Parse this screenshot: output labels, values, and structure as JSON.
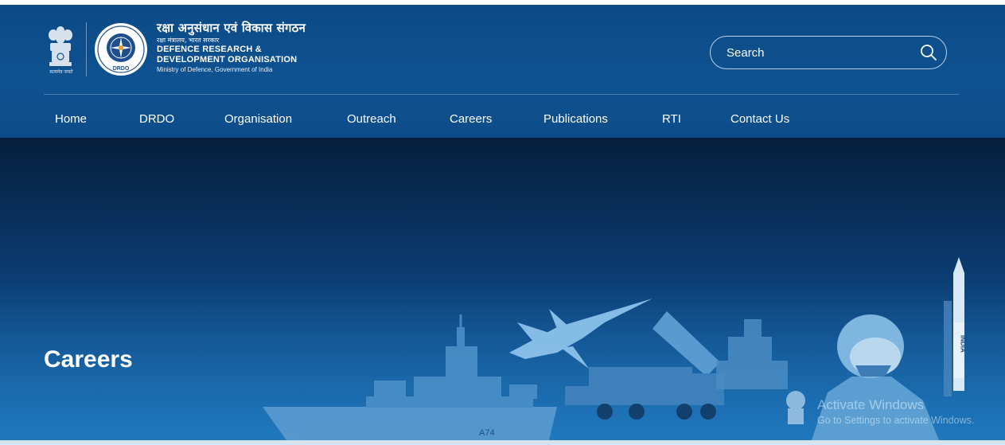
{
  "brand": {
    "emblem_motto": "सत्यमेव जयते",
    "hindi_name": "रक्षा अनुसंधान एवं विकास संगठन",
    "hindi_ministry": "रक्षा मंत्रालय, भारत सरकार",
    "english_name_line1": "DEFENCE RESEARCH &",
    "english_name_line2": "DEVELOPMENT ORGANISATION",
    "ministry": "Ministry of Defence, Government of India",
    "seal_text": "DRDO"
  },
  "search": {
    "placeholder": "Search",
    "icon": "search-icon"
  },
  "nav": {
    "items": [
      {
        "label": "Home"
      },
      {
        "label": "DRDO"
      },
      {
        "label": "Organisation"
      },
      {
        "label": "Outreach"
      },
      {
        "label": "Careers"
      },
      {
        "label": "Publications"
      },
      {
        "label": "RTI"
      },
      {
        "label": "Contact Us"
      }
    ]
  },
  "hero": {
    "title": "Careers",
    "ship_hull_number": "A74",
    "missile_text": "INDIA"
  },
  "watermark": {
    "title": "Activate Windows",
    "subtitle": "Go to Settings to activate Windows."
  },
  "colors": {
    "header_bg": "#0e5291",
    "hero_dark": "#061f3c",
    "hero_light": "#1366ad",
    "text": "#ffffff"
  }
}
